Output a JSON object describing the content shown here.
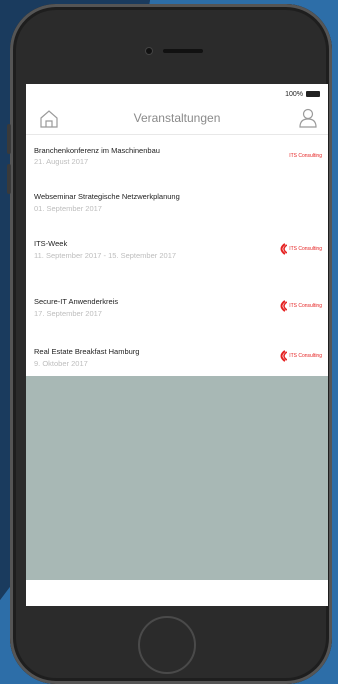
{
  "status_bar": {
    "battery": "100%"
  },
  "nav": {
    "title": "Veranstaltungen",
    "home_icon": "home-icon",
    "user_icon": "user-icon"
  },
  "events": [
    {
      "title": "Branchenkonferenz im Maschinenbau",
      "date": "21. August 2017",
      "logo": "ITS Consulting",
      "logo_style": "text"
    },
    {
      "title": "Webseminar Strategische Netzwerkplanung",
      "date": "01. September 2017",
      "logo": "",
      "logo_style": "none"
    },
    {
      "title": "ITS-Week",
      "date": "11. September 2017 - 15. September 2017",
      "logo": "ITS Consulting",
      "logo_style": "mark"
    },
    {
      "title": "Secure-IT Anwenderkreis",
      "date": "17. September 2017",
      "logo": "ITS Consulting",
      "logo_style": "mark"
    },
    {
      "title": "Real Estate Breakfast Hamburg",
      "date": "9. Oktober 2017",
      "logo": "ITS Consulting",
      "logo_style": "mark"
    }
  ],
  "colors": {
    "brand": "#e52222",
    "empty_area": "#a8b8b5",
    "background": "#1a3b5e"
  }
}
